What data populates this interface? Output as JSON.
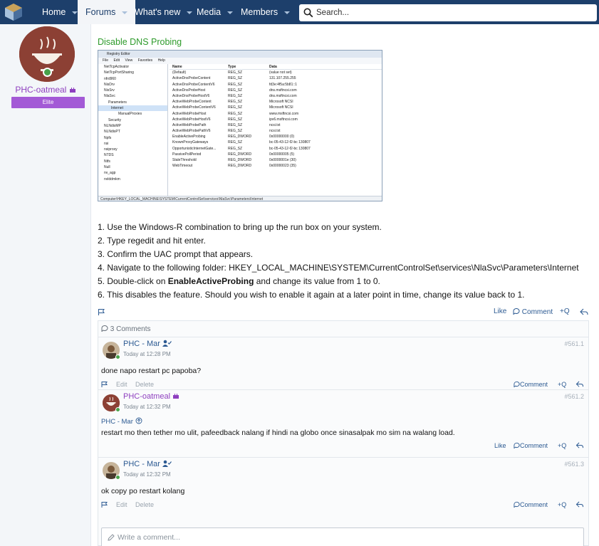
{
  "nav": {
    "items": [
      {
        "label": "Home"
      },
      {
        "label": "Forums"
      },
      {
        "label": "What's new"
      },
      {
        "label": "Media"
      },
      {
        "label": "Members"
      }
    ],
    "search_placeholder": "Search..."
  },
  "author": {
    "name": "PHC-oatmeal",
    "rank": "Elite"
  },
  "post": {
    "title": "Disable DNS Probing",
    "steps": [
      {
        "text": "1. Use the Windows-R combination to bring up the run box on your system."
      },
      {
        "text": "2. Type regedit and hit enter."
      },
      {
        "text": "3. Confirm the UAC prompt that appears."
      },
      {
        "text": "4. Navigate to the following folder: HKEY_LOCAL_MACHINE\\SYSTEM\\CurrentControlSet\\services\\NlaSvc\\Parameters\\Internet"
      },
      {
        "pre": "5. Double-click on ",
        "bold": "EnableActiveProbing",
        "post": " and change its value from 1 to 0."
      },
      {
        "text": "6. This disables the feature. Should you wish to enable it again at a later point in time, change its value back to 1."
      }
    ],
    "actions": {
      "like": "Like",
      "comment": "Comment",
      "quote": "+Q"
    }
  },
  "registry": {
    "title": "Registry Editor",
    "menu": [
      "File",
      "Edit",
      "View",
      "Favorites",
      "Help"
    ],
    "tree": [
      "NetTcpActivator",
      "NetTcpPortSharing",
      "nfrd960",
      "NisDrv",
      "NisSrv",
      "NlaSvc",
      "Parameters",
      "Internet",
      "ManualProxies",
      "Security",
      "NLNdisMP",
      "NLNdisPT",
      "Npfs",
      "nsi",
      "nsiproxy",
      "NTDS",
      "Ntfs",
      "Null",
      "nv_agp",
      "nvlddmkm"
    ],
    "columns": [
      "Name",
      "Type",
      "Data"
    ],
    "rows": [
      [
        "(Default)",
        "REG_SZ",
        "(value not set)"
      ],
      [
        "ActiveDnsProbeContent",
        "REG_SZ",
        "131.107.255.255"
      ],
      [
        "ActiveDnsProbeContentV6",
        "REG_SZ",
        "fd3e:4f5a:5b81::1"
      ],
      [
        "ActiveDnsProbeHost",
        "REG_SZ",
        "dns.msftncsi.com"
      ],
      [
        "ActiveDnsProbeHostV6",
        "REG_SZ",
        "dns.msftncsi.com"
      ],
      [
        "ActiveWebProbeContent",
        "REG_SZ",
        "Microsoft NCSI"
      ],
      [
        "ActiveWebProbeContentV6",
        "REG_SZ",
        "Microsoft NCSI"
      ],
      [
        "ActiveWebProbeHost",
        "REG_SZ",
        "www.msftncsi.com"
      ],
      [
        "ActiveWebProbeHostV6",
        "REG_SZ",
        "ipv6.msftncsi.com"
      ],
      [
        "ActiveWebProbePath",
        "REG_SZ",
        "ncsi.txt"
      ],
      [
        "ActiveWebProbePathV6",
        "REG_SZ",
        "ncsi.txt"
      ],
      [
        "EnableActiveProbing",
        "REG_DWORD",
        "0x00000000 (0)"
      ],
      [
        "KnownProxyGateways",
        "REG_SZ",
        "bc-05-43-12-f2-bc 130807"
      ],
      [
        "OpportunisticInternetGate...",
        "REG_SZ",
        "bc-05-43-12-f2-bc 130807"
      ],
      [
        "PassivePollPeriod",
        "REG_DWORD",
        "0x00000005 (5)"
      ],
      [
        "StaleThreshold",
        "REG_DWORD",
        "0x0000001e (30)"
      ],
      [
        "WebTimeout",
        "REG_DWORD",
        "0x00000023 (35)"
      ]
    ],
    "status": "Computer\\HKEY_LOCAL_MACHINE\\SYSTEM\\CurrentControlSet\\services\\NlaSvc\\Parameters\\Internet"
  },
  "comments": {
    "header": "3 Comments",
    "items": [
      {
        "author": "PHC - Mar",
        "time": "Today at 12:28 PM",
        "num": "#561.1",
        "text": "done napo restart pc papoba?",
        "edit": "Edit",
        "delete": "Delete",
        "comment": "Comment",
        "quote": "+Q"
      },
      {
        "author": "PHC-oatmeal",
        "time": "Today at 12:32 PM",
        "num": "#561.2",
        "quote_label": "PHC - Mar",
        "text": "restart mo then tether mo ulit, pafeedback nalang if hindi na globo once sinasalpak mo sim na walang load.",
        "like": "Like",
        "comment": "Comment",
        "quote": "+Q"
      },
      {
        "author": "PHC - Mar",
        "time": "Today at 12:32 PM",
        "num": "#561.3",
        "text": "ok copy po restart kolang",
        "edit": "Edit",
        "delete": "Delete",
        "comment": "Comment",
        "quote": "+Q"
      }
    ],
    "input_placeholder": "Write a comment..."
  }
}
